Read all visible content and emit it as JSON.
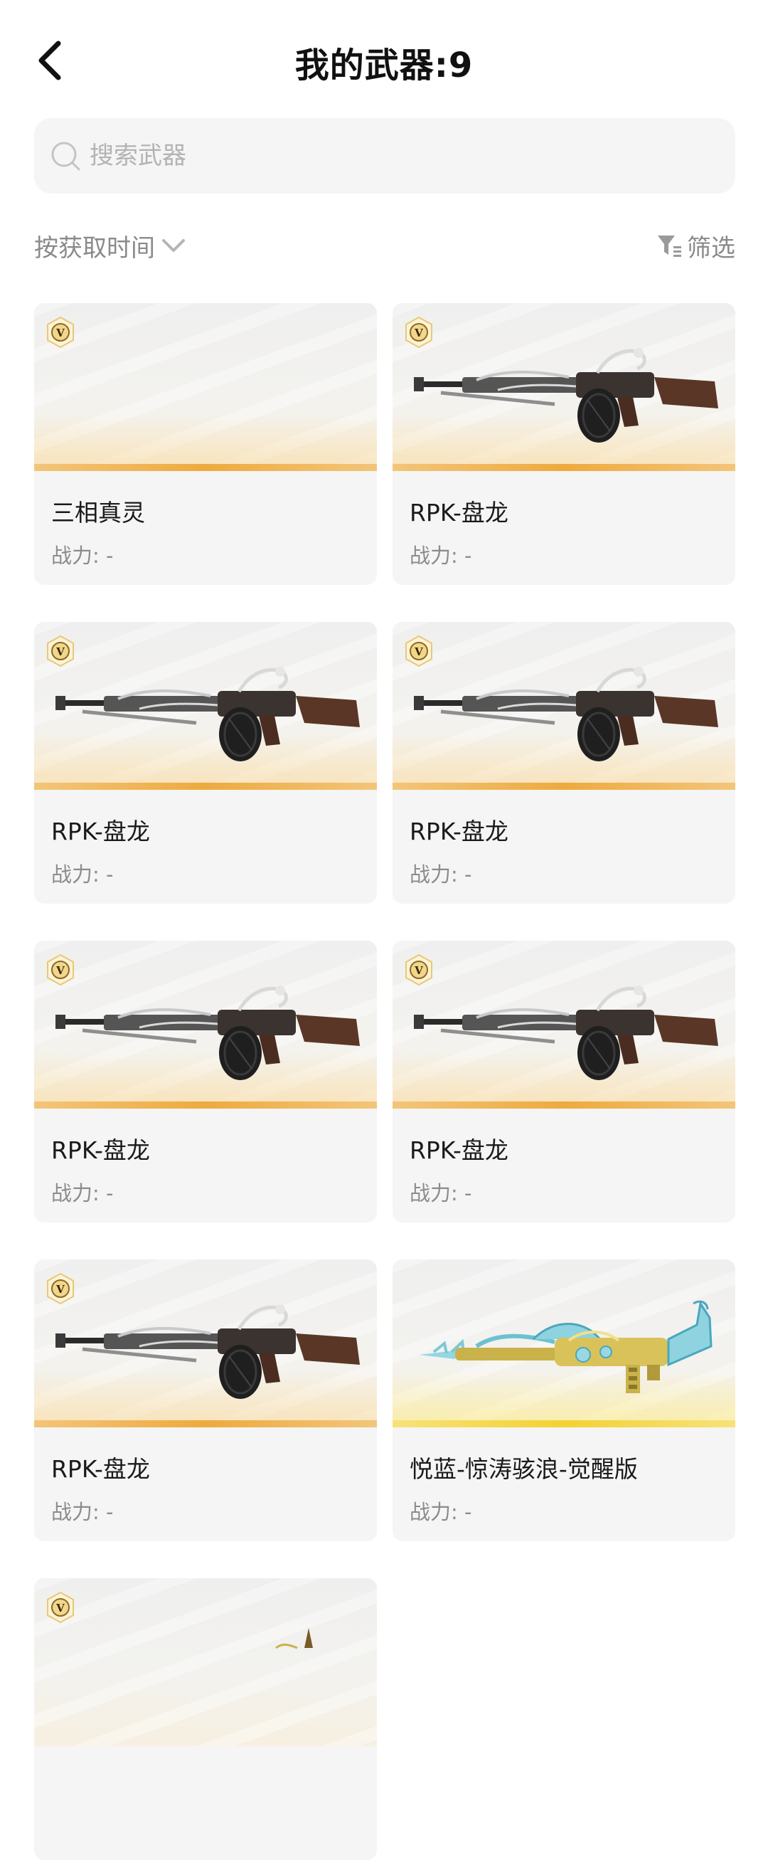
{
  "header": {
    "title": "我的武器:9",
    "back_icon": "chevron-left-icon"
  },
  "search": {
    "placeholder": "搜索武器",
    "value": ""
  },
  "toolbar": {
    "sort_label": "按获取时间",
    "filter_label": "筛选"
  },
  "colors": {
    "card_bg": "#f5f5f5",
    "orange_bar": "#eeaa3e",
    "gold_bar": "#f3d233",
    "muted_text": "#8a8a8a"
  },
  "weapons": [
    {
      "name": "三相真灵",
      "power": "战力: -",
      "badge": "V",
      "image": "none"
    },
    {
      "name": "RPK-盘龙",
      "power": "战力: -",
      "badge": "V",
      "image": "rpk"
    },
    {
      "name": "RPK-盘龙",
      "power": "战力: -",
      "badge": "V",
      "image": "rpk"
    },
    {
      "name": "RPK-盘龙",
      "power": "战力: -",
      "badge": "V",
      "image": "rpk"
    },
    {
      "name": "RPK-盘龙",
      "power": "战力: -",
      "badge": "V",
      "image": "rpk"
    },
    {
      "name": "RPK-盘龙",
      "power": "战力: -",
      "badge": "V",
      "image": "rpk"
    },
    {
      "name": "RPK-盘龙",
      "power": "战力: -",
      "badge": "V",
      "image": "rpk"
    },
    {
      "name": "悦蓝-惊涛骇浪-觉醒版",
      "power": "战力: -",
      "badge": "",
      "image": "dragon-gun"
    },
    {
      "name": "",
      "power": "",
      "badge": "V",
      "image": "partial"
    }
  ]
}
